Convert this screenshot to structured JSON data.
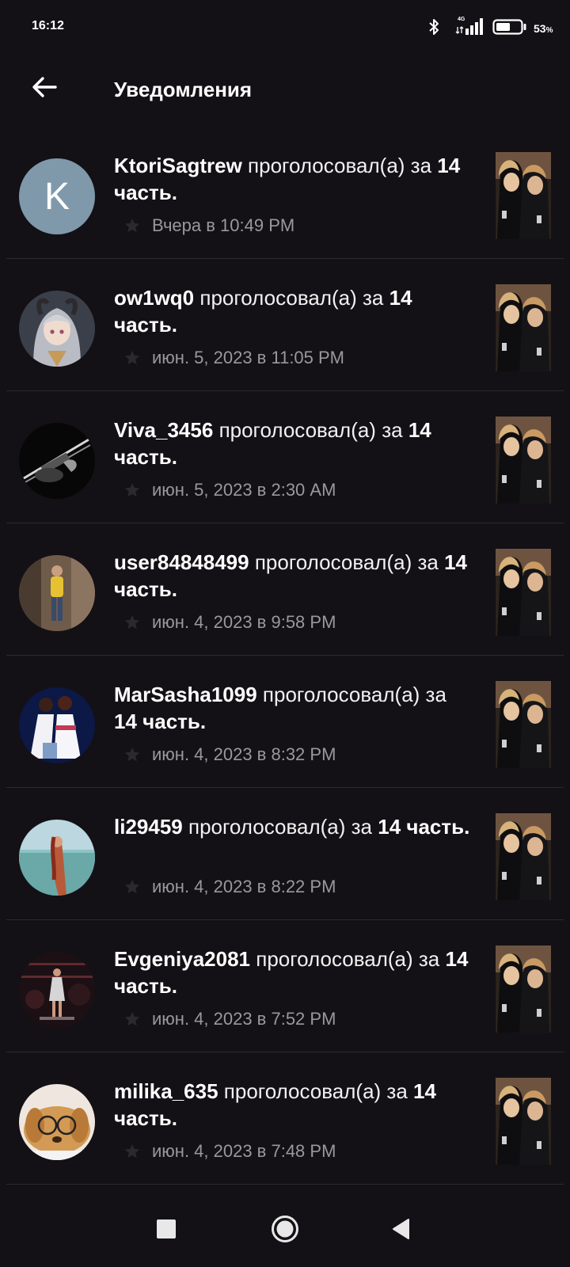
{
  "status_bar": {
    "time": "16:12",
    "network": "4G",
    "battery_percent": "53",
    "battery_level": 0.53,
    "icons": [
      "bluetooth-icon",
      "signal-icon",
      "battery-icon"
    ]
  },
  "app_bar": {
    "title": "Уведомления",
    "back_icon": "arrow-left-icon"
  },
  "action_text": "проголосовал(а) за",
  "notifications": [
    {
      "user": "KtoriSagtrew",
      "action": "проголосовал(а) за",
      "target": "14 часть",
      "time": "Вчера в 10:49 PM",
      "avatar_letter": "K"
    },
    {
      "user": "ow1wq0",
      "action": "проголосовал(а) за",
      "target": "14 часть",
      "time": "июн. 5, 2023 в 11:05 PM"
    },
    {
      "user": "Viva_3456",
      "action": "проголосовал(а) за",
      "target": "14 часть",
      "time": "июн. 5, 2023 в 2:30 AM"
    },
    {
      "user": "user84848499",
      "action": "проголосовал(а) за",
      "target": "14 часть",
      "time": "июн. 4, 2023 в 9:58 PM"
    },
    {
      "user": "MarSasha1099",
      "action": "проголосовал(а) за",
      "target": "14 часть",
      "time": "июн. 4, 2023 в 8:32 PM"
    },
    {
      "user": "li29459",
      "action": "проголосовал(а) за",
      "target": "14 часть",
      "time": "июн. 4, 2023 в 8:22 PM"
    },
    {
      "user": "Evgeniya2081",
      "action": "проголосовал(а) за",
      "target": "14 часть",
      "time": "июн. 4, 2023 в 7:52 PM"
    },
    {
      "user": "milika_635",
      "action": "проголосовал(а) за",
      "target": "14 часть",
      "time": "июн. 4, 2023 в 7:48 PM"
    }
  ],
  "nav_bar": {
    "icons": [
      "recents-square-icon",
      "home-circle-icon",
      "back-triangle-icon"
    ]
  },
  "colors": {
    "background": "#131115",
    "text_primary": "#ffffff",
    "text_secondary": "#9a989d",
    "divider": "#2c2a2f",
    "avatar_letter_bg": "#7f99ab"
  }
}
